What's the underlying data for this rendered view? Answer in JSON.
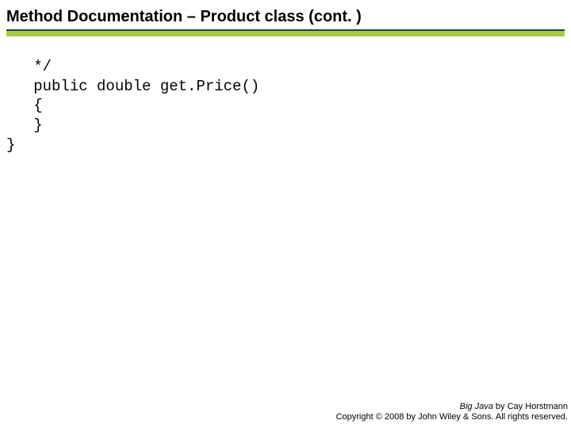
{
  "header": {
    "title": "Method Documentation – Product class  (cont. )"
  },
  "code": {
    "line1": "   */",
    "line2": "   public double get.Price()",
    "line3": "   {",
    "line4": "   }",
    "line5": "}"
  },
  "footer": {
    "book": "Big Java",
    "byline": " by Cay Horstmann",
    "copyright": "Copyright © 2008 by John Wiley & Sons. All rights reserved."
  }
}
